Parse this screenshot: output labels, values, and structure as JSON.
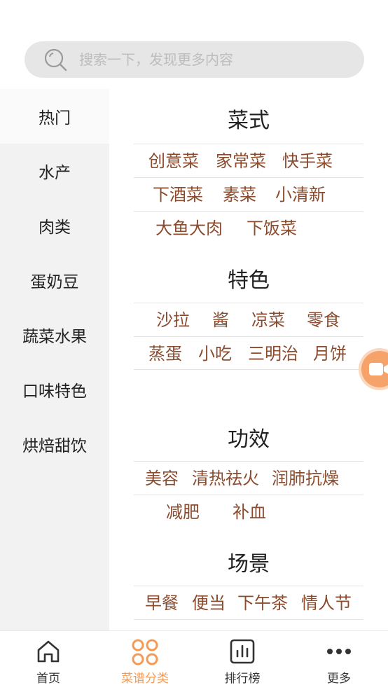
{
  "search": {
    "placeholder": "搜索一下，发现更多内容"
  },
  "sidebar": {
    "items": [
      {
        "label": "热门"
      },
      {
        "label": "水产"
      },
      {
        "label": "肉类"
      },
      {
        "label": "蛋奶豆"
      },
      {
        "label": "蔬菜水果"
      },
      {
        "label": "口味特色"
      },
      {
        "label": "烘焙甜饮"
      }
    ]
  },
  "sections": [
    {
      "title": "菜式",
      "rows": [
        [
          "创意菜",
          "家常菜",
          "快手菜"
        ],
        [
          "下酒菜",
          "素菜",
          "小清新"
        ],
        [
          "大鱼大肉",
          "下饭菜"
        ]
      ]
    },
    {
      "title": "特色",
      "rows": [
        [
          "沙拉",
          "酱",
          "凉菜",
          "零食"
        ],
        [
          "蒸蛋",
          "小吃",
          "三明治",
          "月饼"
        ]
      ]
    },
    {
      "title": "功效",
      "rows": [
        [
          "美容",
          "清热祛火",
          "润肺抗燥"
        ],
        [
          "减肥",
          "补血"
        ]
      ]
    },
    {
      "title": "场景",
      "rows": [
        [
          "早餐",
          "便当",
          "下午茶",
          "情人节"
        ],
        [
          "",
          "",
          ""
        ]
      ]
    }
  ],
  "tabbar": {
    "items": [
      {
        "label": "首页",
        "icon": "home-icon"
      },
      {
        "label": "菜谱分类",
        "icon": "category-icon"
      },
      {
        "label": "排行榜",
        "icon": "ranking-icon"
      },
      {
        "label": "更多",
        "icon": "more-icon"
      }
    ],
    "active_color": "#f39a56"
  },
  "colors": {
    "tag": "#8a4b2e",
    "accent": "#f39a56"
  }
}
